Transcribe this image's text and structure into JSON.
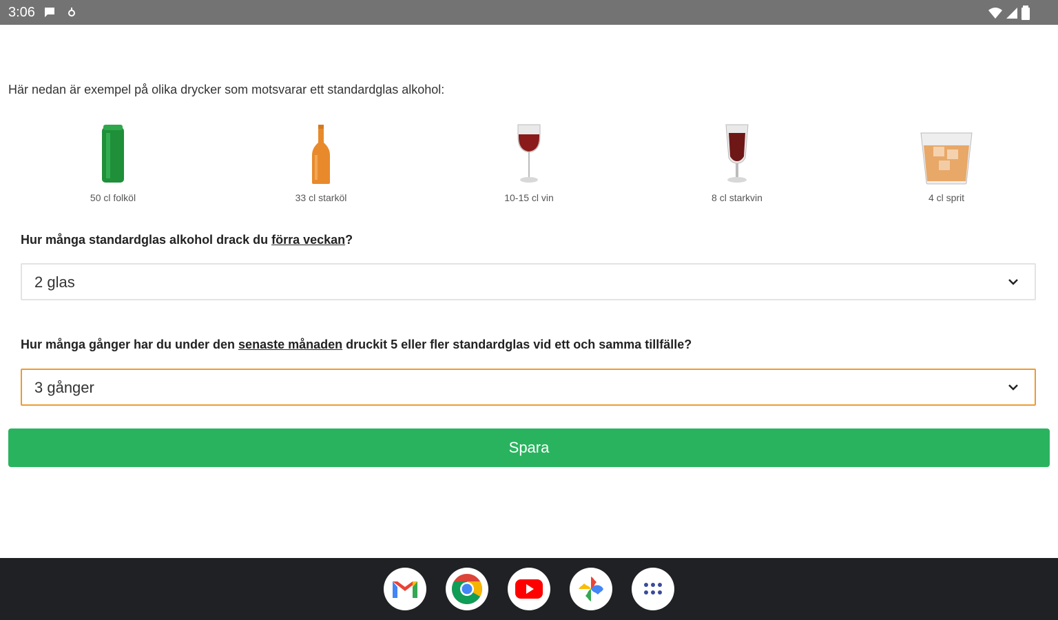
{
  "status_bar": {
    "time": "3:06"
  },
  "intro_text": "Här nedan är exempel på olika drycker som motsvarar ett standardglas alkohol:",
  "drinks": [
    {
      "caption": "50 cl folköl",
      "icon": "beer-can-icon"
    },
    {
      "caption": "33 cl starköl",
      "icon": "beer-bottle-icon"
    },
    {
      "caption": "10-15 cl vin",
      "icon": "wine-glass-icon"
    },
    {
      "caption": "8 cl starkvin",
      "icon": "fortified-wine-glass-icon"
    },
    {
      "caption": "4 cl sprit",
      "icon": "spirits-glass-icon"
    }
  ],
  "q1": {
    "before": "Hur många standardglas alkohol drack du ",
    "underlined": "förra veckan",
    "after": "?",
    "value": "2 glas"
  },
  "q2": {
    "before": "Hur många gånger har du under den ",
    "underlined": "senaste månaden",
    "after": " druckit 5 eller fler standardglas vid ett och samma tillfälle?",
    "value": "3 gånger"
  },
  "save_label": "Spara",
  "dock": {
    "apps": [
      "gmail-icon",
      "chrome-icon",
      "youtube-icon",
      "photos-icon",
      "app-drawer-icon"
    ]
  },
  "colors": {
    "accent_green": "#2ab35f",
    "focus_orange": "#ee9a2e",
    "status_gray": "#737373",
    "dock_dark": "#202124"
  }
}
